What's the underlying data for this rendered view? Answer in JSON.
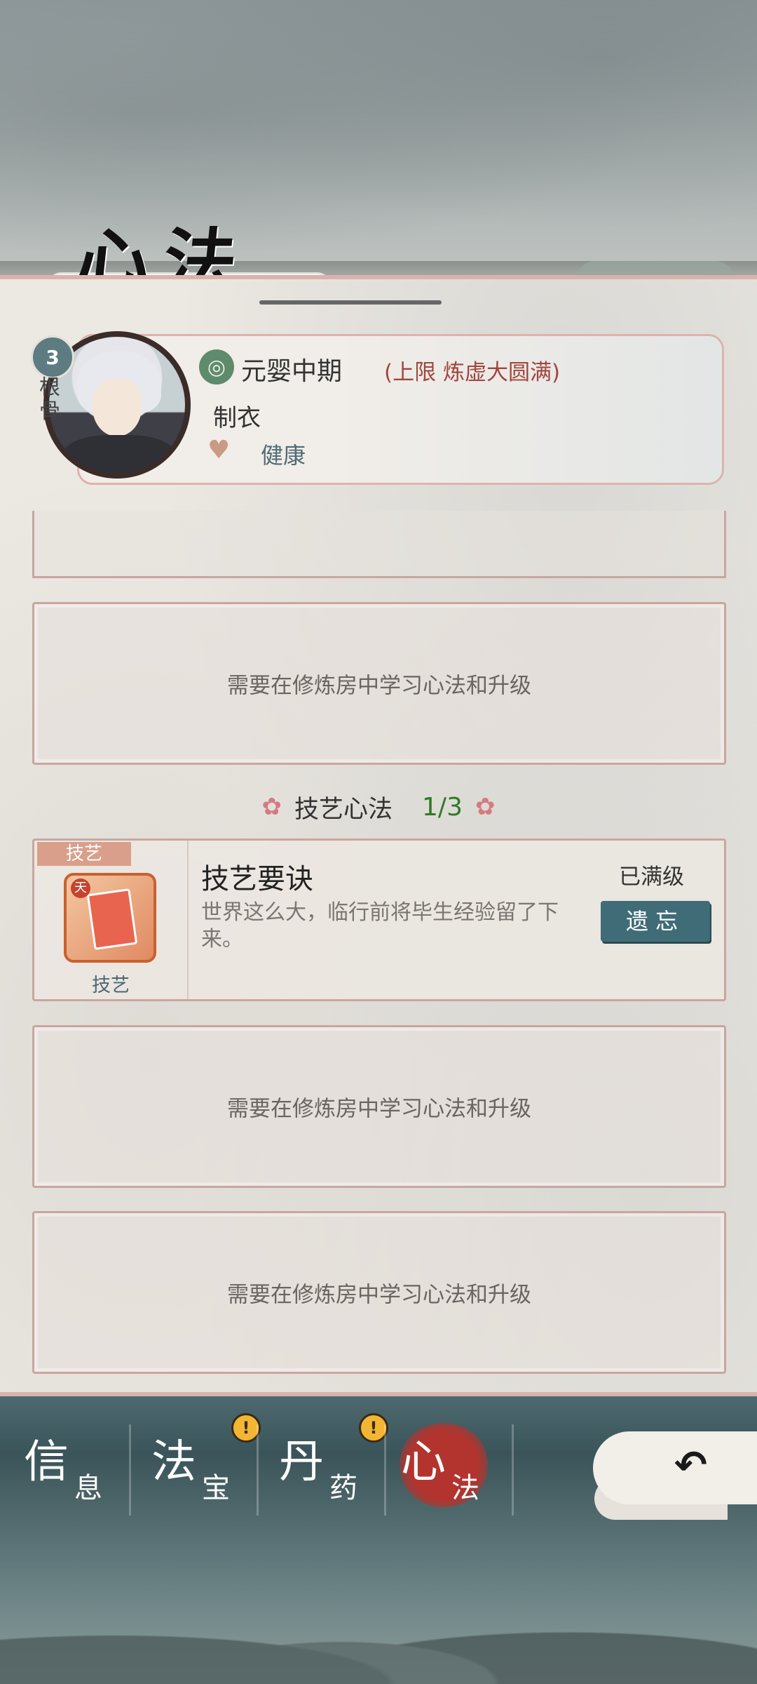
{
  "header": {
    "title": "心法"
  },
  "character": {
    "level": "3",
    "genggu_label": "根骨",
    "realm": "元婴中期",
    "realm_limit": "(上限 炼虚大圆满)",
    "craft": "制衣",
    "health_status": "健康"
  },
  "slots": {
    "empty_text": "需要在修炼房中学习心法和升级"
  },
  "skill_section": {
    "title": "技艺心法",
    "count": "1/3"
  },
  "skill_item": {
    "tag": "技艺",
    "icon_label": "技艺",
    "book_char": "天",
    "name": "技艺要诀",
    "description": "世界这么大，临行前将毕生经验留了下来。",
    "status": "已满级",
    "forget_label": "遗忘"
  },
  "tabs": [
    {
      "big": "信",
      "small": "息"
    },
    {
      "big": "法",
      "small": "宝"
    },
    {
      "big": "丹",
      "small": "药"
    },
    {
      "big": "心",
      "small": "法"
    }
  ],
  "icons": {
    "realm": "realm-spiral-icon",
    "health": "heart-plus-icon",
    "alert": "exclamation-icon",
    "back": "back-arrow-icon"
  },
  "colors": {
    "accent_red": "#b3342e",
    "button_teal": "#3f6c77",
    "count_green": "#2f7a26",
    "limit_red": "#a1463c"
  }
}
